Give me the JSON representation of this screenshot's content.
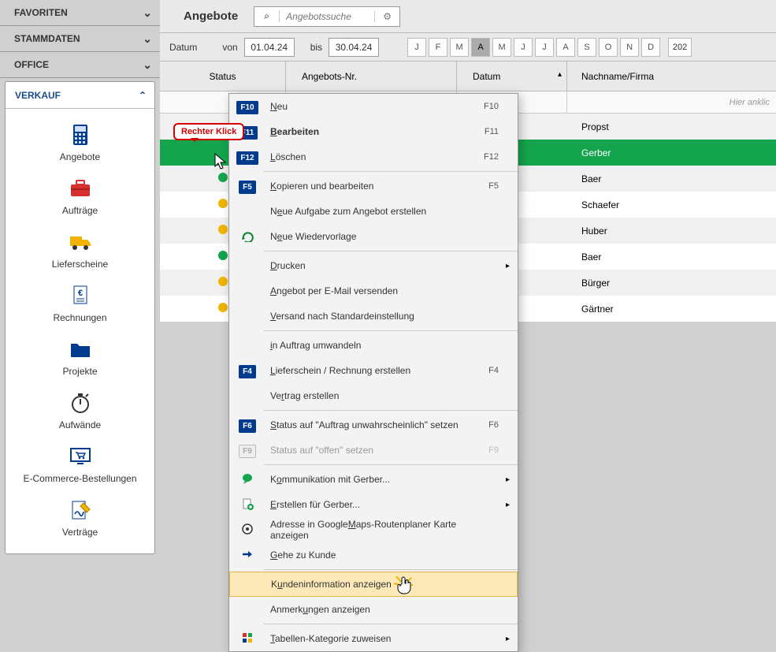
{
  "sidebar": {
    "sections": {
      "favoriten": "FAVORITEN",
      "stammdaten": "STAMMDATEN",
      "office": "OFFICE",
      "verkauf": "VERKAUF"
    },
    "verkauf_items": [
      {
        "label": "Angebote"
      },
      {
        "label": "Aufträge"
      },
      {
        "label": "Lieferscheine"
      },
      {
        "label": "Rechnungen"
      },
      {
        "label": "Projekte"
      },
      {
        "label": "Aufwände"
      },
      {
        "label": "E-Commerce-Bestellungen"
      },
      {
        "label": "Verträge"
      }
    ]
  },
  "header": {
    "title": "Angebote",
    "search_placeholder": "Angebotssuche"
  },
  "filter": {
    "datum": "Datum",
    "von": "von",
    "bis": "bis",
    "date_from": "01.04.24",
    "date_to": "30.04.24",
    "months": [
      "J",
      "F",
      "M",
      "A",
      "M",
      "J",
      "J",
      "A",
      "S",
      "O",
      "N",
      "D"
    ],
    "year_partial": "202"
  },
  "table": {
    "cols": {
      "status": "Status",
      "nr": "Angebots-Nr.",
      "datum": "Datum",
      "name": "Nachname/Firma"
    },
    "filter_hint": "Hier anklic"
  },
  "rows": [
    {
      "dot": "",
      "name": "Propst"
    },
    {
      "dot": "",
      "name": "Gerber",
      "selected": true
    },
    {
      "dot": "#14a44d",
      "name": "Baer"
    },
    {
      "dot": "#f0b400",
      "name": "Schaefer"
    },
    {
      "dot": "#f0b400",
      "name": "Huber"
    },
    {
      "dot": "#14a44d",
      "name": "Baer"
    },
    {
      "dot": "#f0b400",
      "name": "Bürger"
    },
    {
      "dot": "#f0b400",
      "name": "Gärtner"
    }
  ],
  "tooltip": "Rechter Klick",
  "ctx": {
    "items": [
      {
        "fkey": "F10",
        "label": "<u>N</u>eu",
        "short": "F10"
      },
      {
        "fkey": "F11",
        "label": "<u>B</u>earbeiten",
        "short": "F11",
        "bold": true
      },
      {
        "fkey": "F12",
        "label": "<u>L</u>öschen",
        "short": "F12"
      },
      {
        "sep": true
      },
      {
        "fkey": "F5",
        "label": "<u>K</u>opieren und bearbeiten",
        "short": "F5"
      },
      {
        "label": "N<u>e</u>ue Aufgabe zum Angebot erstellen"
      },
      {
        "icon": "reload",
        "label": "N<u>e</u>ue Wiedervorlage"
      },
      {
        "sep": true
      },
      {
        "label": "<u>D</u>rucken",
        "sub": true
      },
      {
        "label": "<u>A</u>ngebot per E-Mail versenden"
      },
      {
        "label": "<u>V</u>ersand nach Standardeinstellung"
      },
      {
        "sep": true
      },
      {
        "label": "<u>i</u>n Auftrag umwandeln"
      },
      {
        "fkey": "F4",
        "label": "<u>L</u>ieferschein / Rechnung erstellen",
        "short": "F4"
      },
      {
        "label": "Ve<u>r</u>trag erstellen"
      },
      {
        "sep": true
      },
      {
        "fkey": "F6",
        "label": "<u>S</u>tatus auf \"Auftrag unwahrscheinlich\" setzen",
        "short": "F6"
      },
      {
        "fkey": "F9",
        "label": "Status auf \"offen\" setzen",
        "short": "F9",
        "disabled": true
      },
      {
        "sep": true
      },
      {
        "icon": "chat",
        "label": "K<u>o</u>mmunikation mit Gerber...",
        "sub": true
      },
      {
        "icon": "newdoc",
        "label": "<u>E</u>rstellen für Gerber...",
        "sub": true
      },
      {
        "icon": "target",
        "label": "Adresse in Google<u>M</u>aps-Routenplaner Karte anzeigen"
      },
      {
        "icon": "goto",
        "label": "<u>G</u>ehe zu Kunde"
      },
      {
        "sep": true
      },
      {
        "label": "K<u>u</u>ndeninformation anzeigen",
        "hover": true
      },
      {
        "label": "Anmerk<u>u</u>ngen anzeigen"
      },
      {
        "sep": true
      },
      {
        "icon": "cat",
        "label": "<u>T</u>abellen-Kategorie zuweisen",
        "sub": true
      }
    ]
  }
}
